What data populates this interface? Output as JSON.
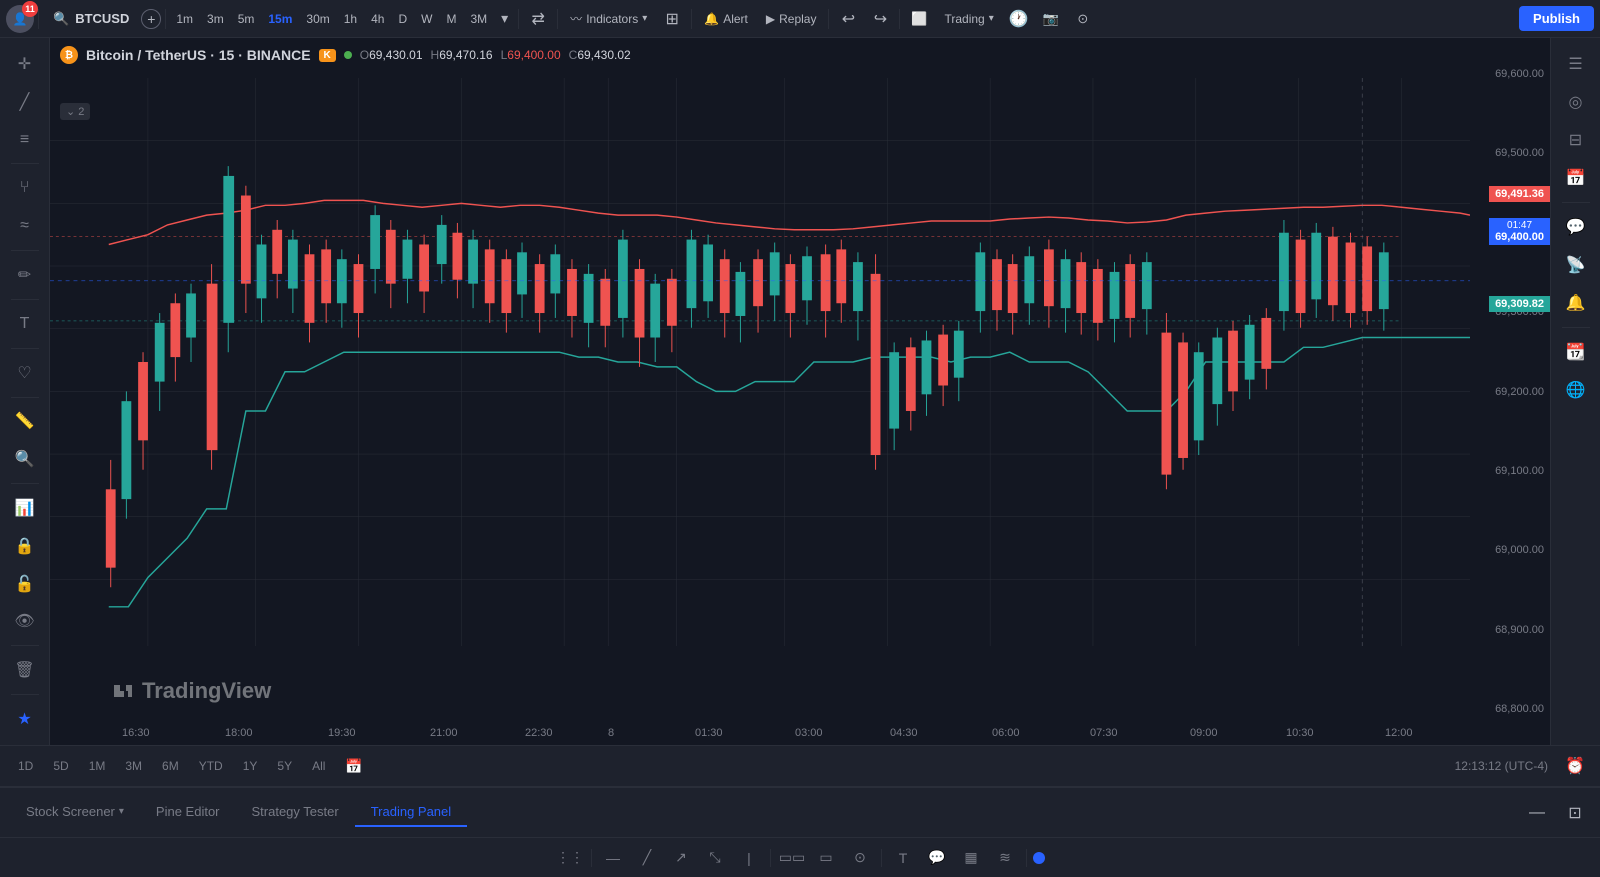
{
  "header": {
    "symbol": "BTCUSD",
    "add_btn": "+",
    "timeframes": [
      "1m",
      "3m",
      "5m",
      "15m",
      "30m",
      "1h",
      "4h",
      "D",
      "W",
      "M",
      "3M"
    ],
    "active_tf": "15m",
    "indicators_label": "Indicators",
    "layout_label": "",
    "alert_label": "Alert",
    "replay_label": "Replay",
    "undo_icon": "↩",
    "redo_icon": "↪",
    "trading_label": "Trading",
    "publish_label": "Publish",
    "notification_count": "11"
  },
  "chart_header": {
    "pair": "Bitcoin / TetherUS · 15 · BINANCE",
    "pine_indicator": "K",
    "open_label": "O",
    "open_val": "69,430.01",
    "high_label": "H",
    "high_val": "69,470.16",
    "low_label": "L",
    "low_val": "69,400.00",
    "close_label": "C",
    "close_val": "69,430.02"
  },
  "price_labels": {
    "red": "69,491.36",
    "blue_time": "01:47",
    "blue_price": "69,400.00",
    "green": "69,309.82"
  },
  "y_axis": {
    "labels": [
      "69,600.00",
      "69,500.00",
      "69,400.00",
      "69,300.00",
      "69,200.00",
      "69,100.00",
      "69,000.00",
      "68,900.00",
      "68,800.00"
    ]
  },
  "x_axis": {
    "labels": [
      "16:30",
      "18:00",
      "19:30",
      "21:00",
      "22:30",
      "8",
      "01:30",
      "03:00",
      "04:30",
      "06:00",
      "07:30",
      "09:00",
      "10:30",
      "12:00"
    ]
  },
  "time_range": {
    "options": [
      "1D",
      "5D",
      "1M",
      "3M",
      "6M",
      "YTD",
      "1Y",
      "5Y",
      "All"
    ],
    "calendar_icon": "📅",
    "time_display": "12:13:12 (UTC-4)"
  },
  "bottom_tabs": {
    "stock_screener": "Stock Screener",
    "pine_editor": "Pine Editor",
    "strategy_tester": "Strategy Tester",
    "trading_panel": "Trading Panel"
  },
  "collapse_indicator": "⌄ 2",
  "watermark": "TradingView",
  "drawing_tools": {
    "tools": [
      "⋮⋮",
      "—",
      "/",
      "↗",
      "⤡",
      "|",
      "▭▭",
      "▭",
      "⊙",
      "T",
      "💬",
      "▦",
      "≋"
    ],
    "color_dot": "#2962ff"
  }
}
